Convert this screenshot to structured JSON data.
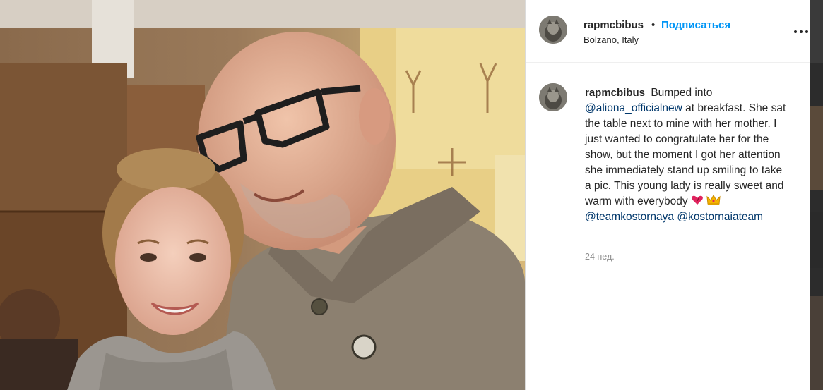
{
  "post": {
    "username": "rapmcbibus",
    "dot": "•",
    "follow_label": "Подписаться",
    "location": "Bolzano, Italy",
    "more_icon": "more-horizontal-icon"
  },
  "caption": {
    "username": "rapmcbibus",
    "text_1": "Bumped into",
    "mention_1": "@aliona_officialnew",
    "text_2": "at breakfast. She sat the table next to mine with her mother. I just wanted to congratulate her for the show, but the moment I got her attention she immediately stand up smiling to take a pic. This young lady is really sweet and warm with everybody",
    "emoji_1": "heart-emoji",
    "emoji_2": "crown-emoji",
    "mention_2": "@teamkostornaya",
    "mention_3": "@kostornaiateam",
    "timestamp": "24 нед."
  },
  "colors": {
    "link": "#0095f6",
    "mention": "#00376b",
    "text": "#262626",
    "muted": "#8e8e8e"
  }
}
